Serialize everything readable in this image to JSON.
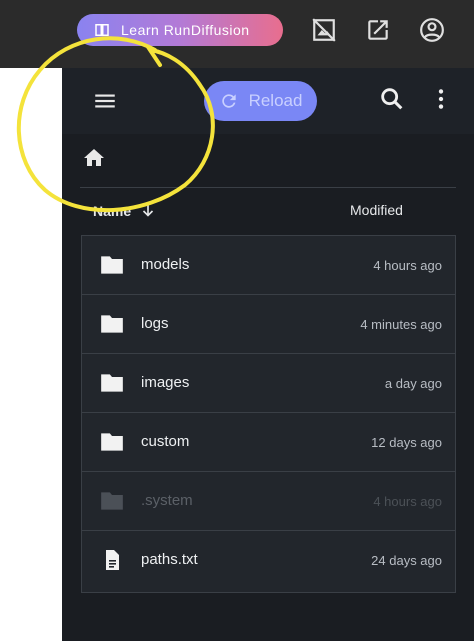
{
  "topbar": {
    "learn_label": "Learn RunDiffusion",
    "icons": [
      "no-image-icon",
      "external-link-icon",
      "account-icon"
    ]
  },
  "toolbar": {
    "reload_label": "Reload",
    "icons": [
      "menu-icon",
      "refresh-icon",
      "search-icon",
      "more-vert-icon"
    ]
  },
  "breadcrumb": {
    "icon": "home-icon"
  },
  "columns": {
    "name": "Name",
    "modified": "Modified"
  },
  "files": [
    {
      "name": "models",
      "modified": "4 hours ago",
      "type": "folder"
    },
    {
      "name": "logs",
      "modified": "4 minutes ago",
      "type": "folder"
    },
    {
      "name": "images",
      "modified": "a day ago",
      "type": "folder"
    },
    {
      "name": "custom",
      "modified": "12 days ago",
      "type": "folder"
    },
    {
      "name": ".system",
      "modified": "4 hours ago",
      "type": "folder",
      "dim": true
    },
    {
      "name": "paths.txt",
      "modified": "24 days ago",
      "type": "file"
    }
  ],
  "colors": {
    "panel_bg": "#1a1d22",
    "reload_button": "#7a87f5",
    "annotation_yellow": "#f4e33b"
  }
}
